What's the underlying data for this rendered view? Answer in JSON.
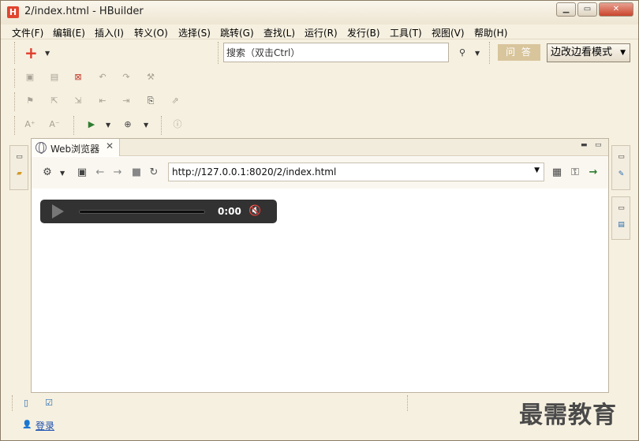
{
  "window": {
    "title": "2/index.html  -  HBuilder",
    "logo": "H"
  },
  "menu": [
    "文件(F)",
    "编辑(E)",
    "插入(I)",
    "转义(O)",
    "选择(S)",
    "跳转(G)",
    "查找(L)",
    "运行(R)",
    "发行(B)",
    "工具(T)",
    "视图(V)",
    "帮助(H)"
  ],
  "toolbar": {
    "search_placeholder": "搜索（双击Ctrl）",
    "qa_label": "问 答",
    "mode_label": "边改边看模式"
  },
  "browser_tab": {
    "label": "Web浏览器"
  },
  "browser": {
    "url": "http://127.0.0.1:8020/2/index.html"
  },
  "player": {
    "time": "0:00"
  },
  "footer": {
    "login": "登录"
  },
  "watermark": "最需教育",
  "colors": {
    "accent_red": "#e03c2a",
    "link_blue": "#1a4fb0",
    "qa_gold": "#d8c59c"
  }
}
